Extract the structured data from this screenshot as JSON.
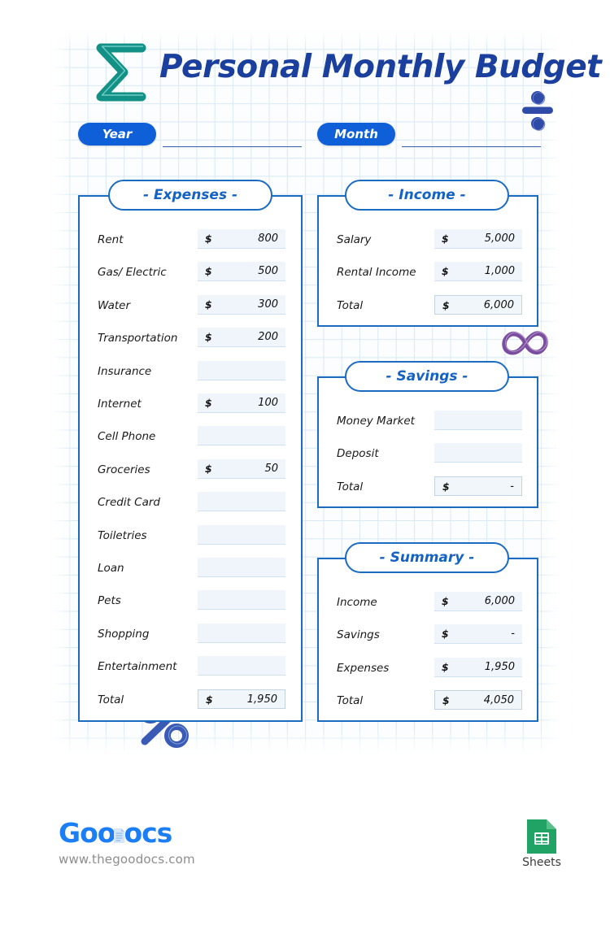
{
  "header": {
    "title": "Personal Monthly Budget",
    "sigma_icon": "sigma-icon",
    "divide_icon": "divide-icon",
    "year_label": "Year",
    "month_label": "Month",
    "year_value": "",
    "month_value": ""
  },
  "decorations": {
    "infinity_icon": "infinity-icon",
    "percent_icon": "percent-icon",
    "sigma_color": "#149186",
    "divide_color": "#2f4ba8",
    "infinity_color": "#7b4d9e",
    "percent_color": "#3a5bb5",
    "accent_blue": "#1b6bc0",
    "pill_blue": "#0e5fd8",
    "title_blue": "#1b3f9c"
  },
  "expenses": {
    "tab_label": "- Expenses -",
    "rows": [
      {
        "label": "Rent",
        "currency": "$",
        "amount": "800"
      },
      {
        "label": "Gas/ Electric",
        "currency": "$",
        "amount": "500"
      },
      {
        "label": "Water",
        "currency": "$",
        "amount": "300"
      },
      {
        "label": "Transportation",
        "currency": "$",
        "amount": "200"
      },
      {
        "label": "Insurance",
        "currency": "",
        "amount": ""
      },
      {
        "label": "Internet",
        "currency": "$",
        "amount": "100"
      },
      {
        "label": "Cell Phone",
        "currency": "",
        "amount": ""
      },
      {
        "label": "Groceries",
        "currency": "$",
        "amount": "50"
      },
      {
        "label": "Credit Card",
        "currency": "",
        "amount": ""
      },
      {
        "label": "Toiletries",
        "currency": "",
        "amount": ""
      },
      {
        "label": "Loan",
        "currency": "",
        "amount": ""
      },
      {
        "label": "Pets",
        "currency": "",
        "amount": ""
      },
      {
        "label": "Shopping",
        "currency": "",
        "amount": ""
      },
      {
        "label": "Entertainment",
        "currency": "",
        "amount": ""
      }
    ],
    "total": {
      "label": "Total",
      "currency": "$",
      "amount": "1,950"
    }
  },
  "income": {
    "tab_label": "- Income -",
    "rows": [
      {
        "label": "Salary",
        "currency": "$",
        "amount": "5,000"
      },
      {
        "label": "Rental Income",
        "currency": "$",
        "amount": "1,000"
      }
    ],
    "total": {
      "label": "Total",
      "currency": "$",
      "amount": "6,000"
    }
  },
  "savings": {
    "tab_label": "- Savings -",
    "rows": [
      {
        "label": "Money Market",
        "currency": "",
        "amount": ""
      },
      {
        "label": "Deposit",
        "currency": "",
        "amount": ""
      }
    ],
    "total": {
      "label": "Total",
      "currency": "$",
      "amount": "-"
    }
  },
  "summary": {
    "tab_label": "- Summary -",
    "rows": [
      {
        "label": "Income",
        "currency": "$",
        "amount": "6,000"
      },
      {
        "label": "Savings",
        "currency": "$",
        "amount": "-"
      },
      {
        "label": "Expenses",
        "currency": "$",
        "amount": "1,950"
      }
    ],
    "total": {
      "label": "Total",
      "currency": "$",
      "amount": "4,050"
    }
  },
  "footer": {
    "logo_part1": "Goo",
    "logo_part2": "ocs",
    "url": "www.thegoodocs.com",
    "sheets_label": "Sheets",
    "sheets_icon": "google-sheets-icon"
  }
}
